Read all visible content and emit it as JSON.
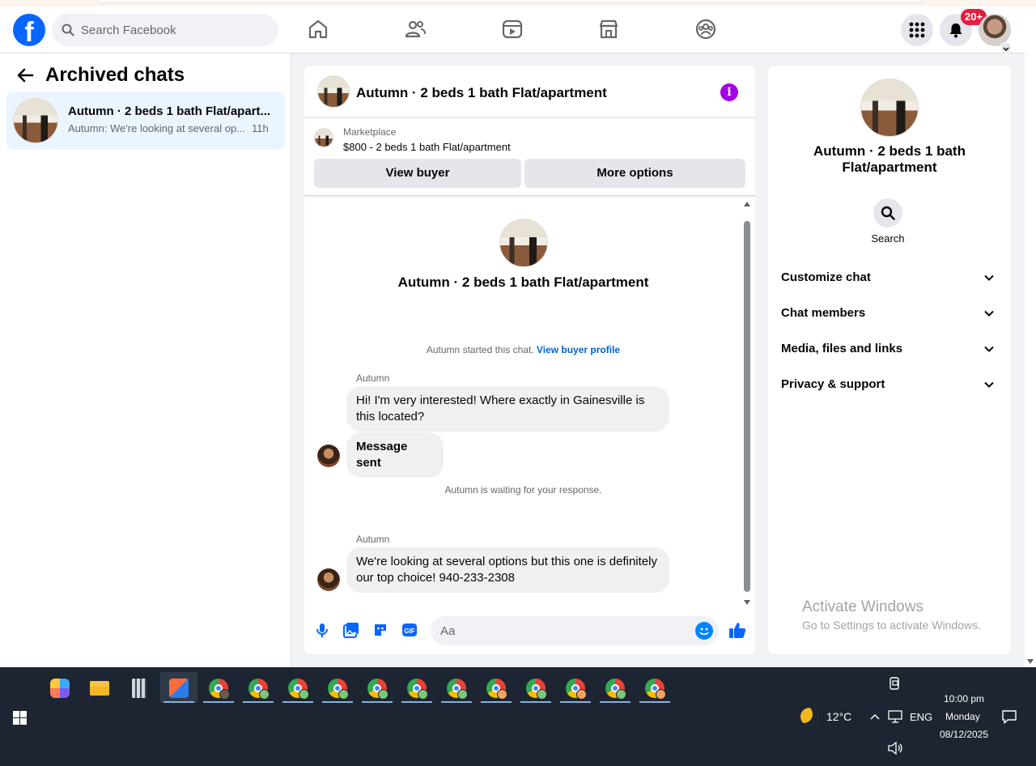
{
  "header": {
    "search_placeholder": "Search Facebook",
    "notification_badge": "20+",
    "nav_icons": [
      "home-icon",
      "friends-icon",
      "video-icon",
      "marketplace-icon",
      "groups-icon"
    ],
    "brand_color": "#0866ff"
  },
  "left": {
    "title": "Archived chats",
    "chats": [
      {
        "name": "Autumn · 2 beds 1 bath Flat/apart...",
        "snippet": "Autumn: We're looking at several op...",
        "time": "11h"
      }
    ]
  },
  "chat": {
    "title": "Autumn · 2 beds 1 bath Flat/apartment",
    "marketplace_label": "Marketplace",
    "listing": "$800 - 2 beds 1 bath Flat/apartment",
    "view_buyer": "View buyer",
    "more_options": "More options",
    "intro_title": "Autumn · 2 beds 1 bath Flat/apartment",
    "started_text": "Autumn started this chat.",
    "view_profile_link": "View buyer profile",
    "messages": [
      {
        "sender": "Autumn",
        "text": "Hi! I'm very interested! Where exactly in Gainesville is this located?",
        "line1": "Hi! I'm very interested! Where exactly in Gainesville is",
        "line2": "this located?"
      },
      {
        "text": "Message sent"
      },
      {
        "sender": "Autumn",
        "line1": "We're looking at several options but this one is definitely",
        "line2": "our top choice! 940-233-2308"
      }
    ],
    "waiting_text": "Autumn is waiting for your response.",
    "composer_placeholder": "Aa"
  },
  "info": {
    "title": "Autumn · 2 beds 1 bath Flat/apartment",
    "title_line1": "Autumn · 2 beds 1 bath",
    "title_line2": "Flat/apartment",
    "search_label": "Search",
    "sections": [
      "Customize chat",
      "Chat members",
      "Media, files and links",
      "Privacy & support"
    ],
    "watermark_title": "Activate Windows",
    "watermark_sub": "Go to Settings to activate Windows."
  },
  "taskbar": {
    "weather": "12°C",
    "language": "ENG",
    "time": "10:00 pm",
    "day": "Monday",
    "date": "08/12/2025"
  }
}
